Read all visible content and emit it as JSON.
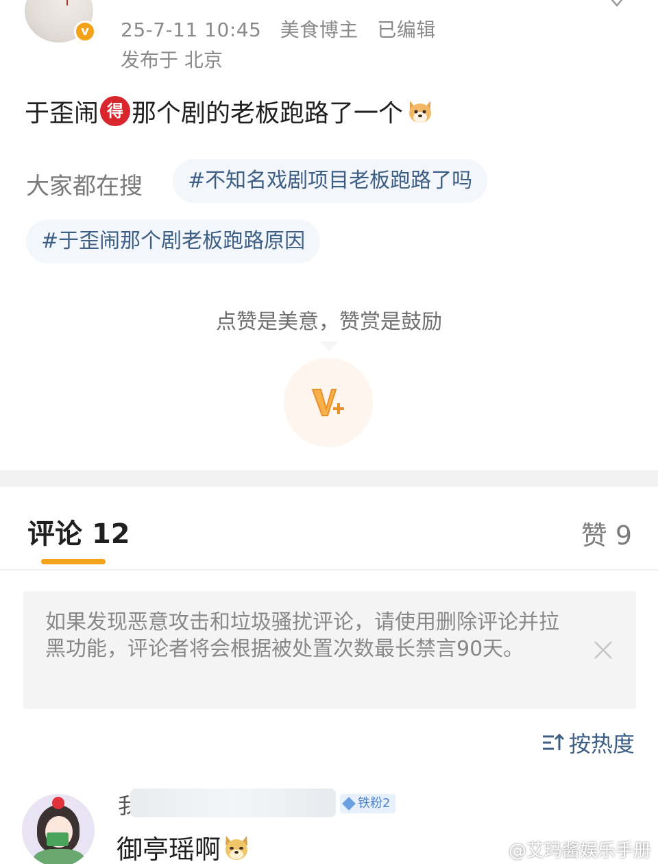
{
  "post": {
    "timestamp": "25-7-11 10:45",
    "author_tag": "美食博主",
    "edited_label": "已编辑",
    "location": "发布于 北京",
    "text_before": "于歪闹",
    "badge_char": "得",
    "text_after": "那个剧的老板跑路了一个"
  },
  "search": {
    "label": "大家都在搜",
    "topics": [
      "#不知名戏剧项目老板跑路了吗",
      "#于歪闹那个剧老板跑路原因"
    ]
  },
  "reward": {
    "prompt": "点赞是美意，赞赏是鼓励"
  },
  "tabs": {
    "comments_label": "评论",
    "comments_count": "12",
    "likes_label": "赞",
    "likes_count": "9"
  },
  "notice": {
    "text": "如果发现恶意攻击和垃圾骚扰评论，请使用删除评论并拉黑功能，评论者将会根据被处置次数最长禁言90天。"
  },
  "sort": {
    "label": "按热度"
  },
  "comment": {
    "name_visible": "我",
    "fan_badge": "铁粉2",
    "text": "御亭瑶啊"
  },
  "watermark": "@艾玛酱娱乐手册",
  "colors": {
    "accent_orange": "#f5a21b",
    "topic_blue": "#3d5f85",
    "badge_red": "#d8262d"
  }
}
